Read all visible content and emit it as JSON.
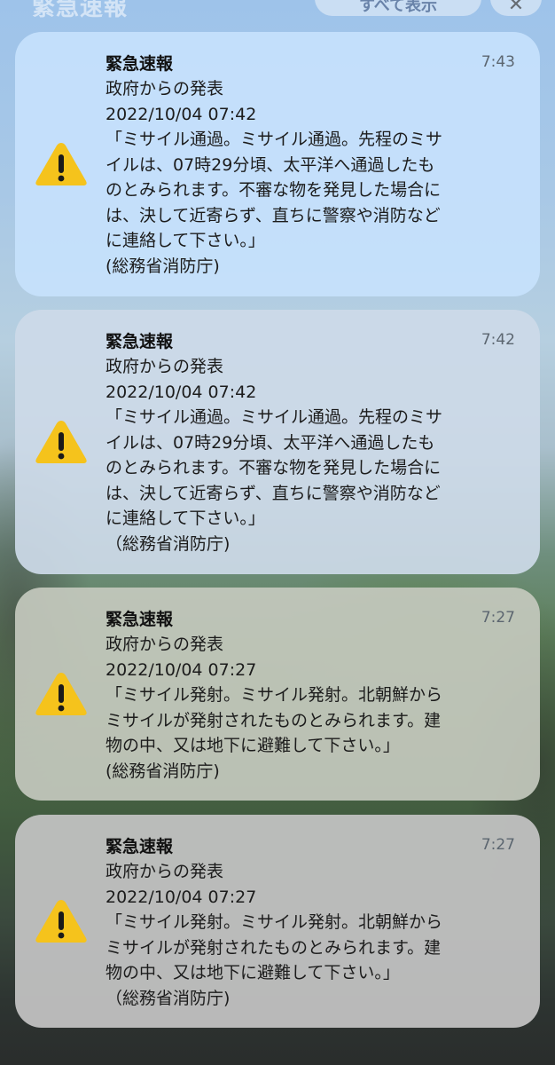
{
  "status_bar": {
    "title": "緊急速報",
    "pill_label": "すべて表示",
    "close_symbol": "✕"
  },
  "notifications": [
    {
      "title": "緊急速報",
      "time": "7:43",
      "lines": [
        "政府からの発表",
        "2022/10/04 07:42",
        "「ミサイル通過。ミサイル通過。先程のミサ",
        "イルは、07時29分頃、太平洋へ通過したも",
        "のとみられます。不審な物を発見した場合に",
        "は、決して近寄らず、直ちに警察や消防など",
        "に連絡して下さい。」",
        "(総務省消防庁)"
      ]
    },
    {
      "title": "緊急速報",
      "time": "7:42",
      "lines": [
        "政府からの発表",
        "2022/10/04 07:42",
        "「ミサイル通過。ミサイル通過。先程のミサ",
        "イルは、07時29分頃、太平洋へ通過したも",
        "のとみられます。不審な物を発見した場合に",
        "は、決して近寄らず、直ちに警察や消防など",
        "に連絡して下さい。」",
        "（総務省消防庁)"
      ]
    },
    {
      "title": "緊急速報",
      "time": "7:27",
      "lines": [
        "政府からの発表",
        "2022/10/04 07:27",
        "「ミサイル発射。ミサイル発射。北朝鮮から",
        "ミサイルが発射されたものとみられます。建",
        "物の中、又は地下に避難して下さい。」",
        "(総務省消防庁)"
      ]
    },
    {
      "title": "緊急速報",
      "time": "7:27",
      "lines": [
        "政府からの発表",
        "2022/10/04 07:27",
        "「ミサイル発射。ミサイル発射。北朝鮮から",
        "ミサイルが発射されたものとみられます。建",
        "物の中、又は地下に避難して下さい。」",
        "（総務省消防庁)"
      ]
    }
  ],
  "icons": {
    "warning": "warning-icon",
    "warning_fill": "#f5c31c",
    "warning_mark": "#1a1a1a"
  }
}
